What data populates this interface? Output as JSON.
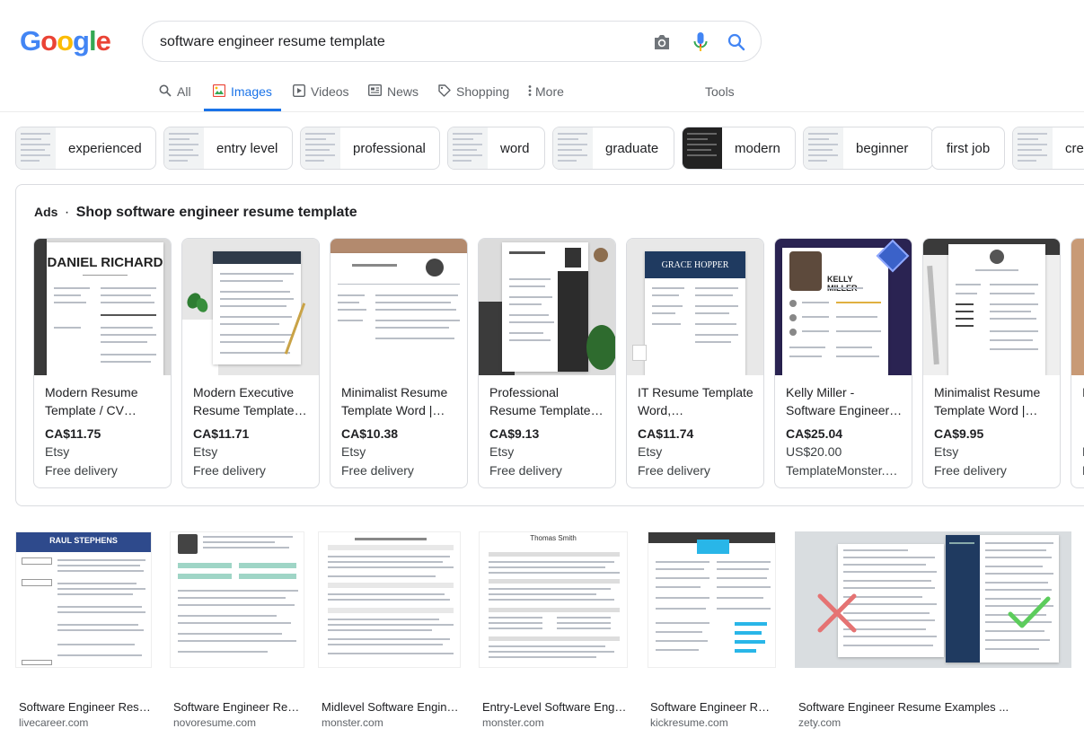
{
  "logo": {
    "letters": [
      "G",
      "o",
      "o",
      "g",
      "l",
      "e"
    ],
    "colors": [
      "#4285f4",
      "#ea4335",
      "#fbbc05",
      "#4285f4",
      "#34a853",
      "#ea4335"
    ]
  },
  "search": {
    "query": "software engineer resume template",
    "camera_icon": "camera-icon",
    "mic_icon": "mic-icon",
    "search_icon": "search-icon"
  },
  "tabs": [
    {
      "label": "All",
      "icon": "search-icon"
    },
    {
      "label": "Images",
      "icon": "image-icon",
      "active": true
    },
    {
      "label": "Videos",
      "icon": "video-icon"
    },
    {
      "label": "News",
      "icon": "news-icon"
    },
    {
      "label": "Shopping",
      "icon": "tag-icon"
    },
    {
      "label": "More",
      "icon": "more-vert-icon"
    }
  ],
  "tools_label": "Tools",
  "chips": [
    "experienced",
    "entry level",
    "professional",
    "word",
    "graduate",
    "modern",
    "beginner",
    "first job",
    "cre"
  ],
  "ads": {
    "tag": "Ads",
    "separator": "·",
    "title": "Shop software engineer resume template",
    "items": [
      {
        "title": "Modern Resume Template / CV…",
        "price": "CA$11.75",
        "seller": "Etsy",
        "delivery": "Free delivery",
        "img_text": "DANIEL RICHARD"
      },
      {
        "title": "Modern Executive Resume Template…",
        "price": "CA$11.71",
        "seller": "Etsy",
        "delivery": "Free delivery",
        "img_text": ""
      },
      {
        "title": "Minimalist Resume Template Word |…",
        "price": "CA$10.38",
        "seller": "Etsy",
        "delivery": "Free delivery",
        "img_text": ""
      },
      {
        "title": "Professional Resume Template…",
        "price": "CA$9.13",
        "seller": "Etsy",
        "delivery": "Free delivery",
        "img_text": ""
      },
      {
        "title": "IT Resume Template Word,…",
        "price": "CA$11.74",
        "seller": "Etsy",
        "delivery": "Free delivery",
        "img_text": "GRACE HOPPER"
      },
      {
        "title": "Kelly Miller - Software Engineer…",
        "price": "CA$25.04",
        "seller": "US$20.00",
        "delivery": "TemplateMonster.…",
        "img_text": "KELLY MILLER"
      },
      {
        "title": "Minimalist Resume Template Word |…",
        "price": "CA$9.95",
        "seller": "Etsy",
        "delivery": "Free delivery",
        "img_text": ""
      },
      {
        "title": "I",
        "price": "",
        "seller": "E",
        "delivery": "F",
        "img_text": ""
      }
    ]
  },
  "results": [
    {
      "title": "Software Engineer Resu…",
      "site": "livecareer.com",
      "img_text": "RAUL STEPHENS"
    },
    {
      "title": "Software Engineer Res…",
      "site": "novoresume.com",
      "img_text": ""
    },
    {
      "title": "Midlevel Software Engine…",
      "site": "monster.com",
      "img_text": ""
    },
    {
      "title": "Entry-Level Software Engin…",
      "site": "monster.com",
      "img_text": "Thomas Smith"
    },
    {
      "title": "Software Engineer Res…",
      "site": "kickresume.com",
      "img_text": ""
    },
    {
      "title": "Software Engineer Resume Examples ...",
      "site": "zety.com",
      "img_text": ""
    }
  ]
}
